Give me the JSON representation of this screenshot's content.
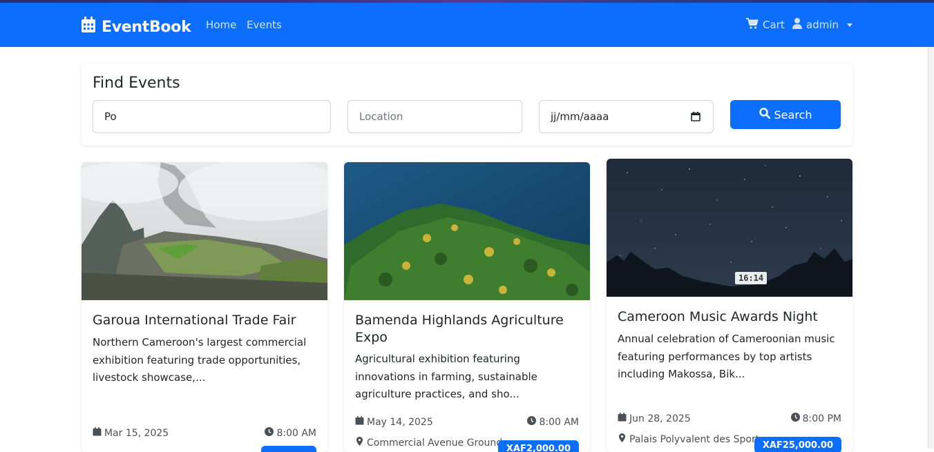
{
  "brand": {
    "name": "EventBook"
  },
  "nav": {
    "home": "Home",
    "events": "Events",
    "cart": "Cart",
    "user": "admin"
  },
  "search": {
    "title": "Find Events",
    "keyword_value": "Po",
    "location_placeholder": "Location",
    "date_placeholder": "jj/mm/aaaa",
    "button_label": "Search"
  },
  "events": [
    {
      "title": "Garoua International Trade Fair",
      "description": "Northern Cameroon's largest commercial exhibition featuring trade opportunities, livestock showcase,...",
      "date": "Mar 15, 2025",
      "time": "8:00 AM"
    },
    {
      "title": "Bamenda Highlands Agriculture Expo",
      "description": "Agricultural exhibition featuring innovations in farming, sustainable agriculture practices, and sho...",
      "date": "May 14, 2025",
      "time": "8:00 AM",
      "location": "Commercial Avenue Grounds,",
      "price": "XAF2,000.00"
    },
    {
      "title": "Cameroon Music Awards Night",
      "description": "Annual celebration of Cameroonian music featuring performances by top artists including Makossa, Bik...",
      "date": "Jun 28, 2025",
      "time": "8:00 PM",
      "location": "Palais Polyvalent des Sports,",
      "price": "XAF25,000.00",
      "video_duration": "16:14"
    }
  ],
  "colors": {
    "primary": "#0d6efd",
    "text": "#212529",
    "muted": "#495057"
  }
}
